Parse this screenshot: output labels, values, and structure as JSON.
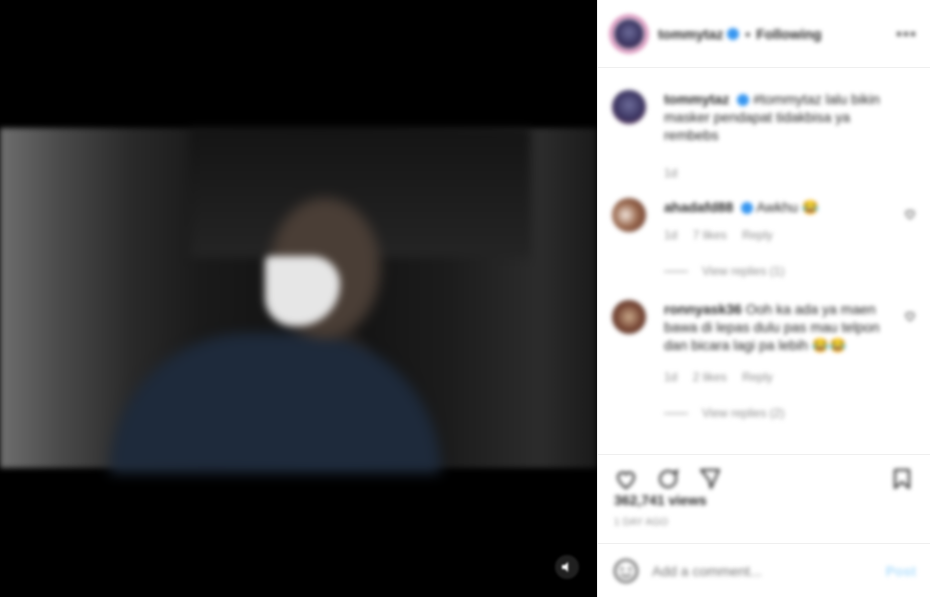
{
  "post": {
    "username": "tommytaz",
    "follow_status": "Following",
    "separator": "•"
  },
  "caption": {
    "username": "tommytaz",
    "text": "#tommytaz lalu bikin masker pendapat tidakbisa ya rembebs",
    "time": "1d"
  },
  "comments": [
    {
      "username": "ahadafd88",
      "text": "Awkhu 😂",
      "time": "1d",
      "likes": "7 likes",
      "reply_label": "Reply",
      "view_replies": "View replies (1)"
    },
    {
      "username": "ronnyask36",
      "text": "Ooh ka ada ya maen bawa di lepas dulu pas mau telpon dan bicara lagi pa lebih 😂😂",
      "time": "1d",
      "likes": "2 likes",
      "reply_label": "Reply",
      "view_replies": "View replies (2)"
    }
  ],
  "stats": {
    "views": "362,741 views",
    "date": "1 DAY AGO"
  },
  "composer": {
    "placeholder": "Add a comment...",
    "post_label": "Post"
  },
  "icons": {
    "more": "more-horizontal-icon",
    "like": "heart-icon",
    "comment": "comment-icon",
    "share": "share-icon",
    "save": "bookmark-icon",
    "emoji": "emoji-icon",
    "mute": "mute-icon"
  },
  "colors": {
    "verified": "#3897f0",
    "post_button_disabled": "#b2dffc",
    "secondary_text": "#8e8e8e"
  }
}
